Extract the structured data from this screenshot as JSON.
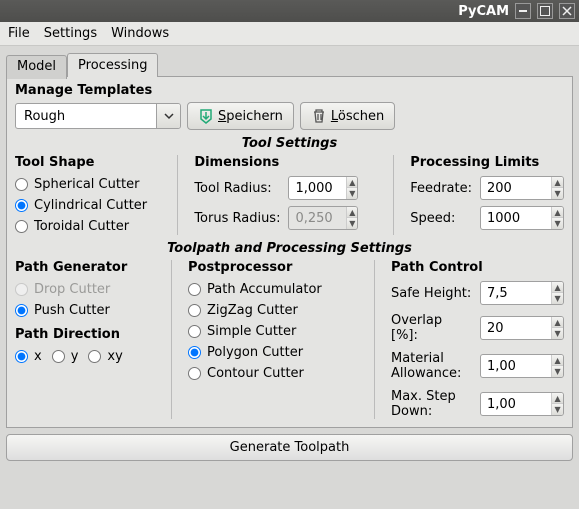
{
  "window": {
    "title": "PyCAM"
  },
  "menu": {
    "file": "File",
    "settings": "Settings",
    "windows": "Windows"
  },
  "tabs": {
    "model": "Model",
    "processing": "Processing"
  },
  "templates": {
    "heading": "Manage Templates",
    "value": "Rough",
    "save": "Speichern",
    "delete": "Löschen"
  },
  "tool_settings": {
    "title": "Tool Settings",
    "shape": {
      "heading": "Tool Shape",
      "spherical": "Spherical Cutter",
      "cylindrical": "Cylindrical Cutter",
      "toroidal": "Toroidal Cutter"
    },
    "dimensions": {
      "heading": "Dimensions",
      "tool_radius_label": "Tool Radius:",
      "tool_radius_value": "1,000",
      "torus_radius_label": "Torus Radius:",
      "torus_radius_value": "0,250"
    },
    "limits": {
      "heading": "Processing Limits",
      "feedrate_label": "Feedrate:",
      "feedrate_value": "200",
      "speed_label": "Speed:",
      "speed_value": "1000"
    }
  },
  "toolpath": {
    "title": "Toolpath and Processing Settings",
    "generator": {
      "heading": "Path Generator",
      "drop": "Drop Cutter",
      "push": "Push Cutter"
    },
    "direction": {
      "heading": "Path Direction",
      "x": "x",
      "y": "y",
      "xy": "xy"
    },
    "postprocessor": {
      "heading": "Postprocessor",
      "accumulator": "Path Accumulator",
      "zigzag": "ZigZag Cutter",
      "simple": "Simple Cutter",
      "polygon": "Polygon Cutter",
      "contour": "Contour Cutter"
    },
    "control": {
      "heading": "Path Control",
      "safe_height_label": "Safe Height:",
      "safe_height_value": "7,5",
      "overlap_label": "Overlap [%]:",
      "overlap_value": "20",
      "allowance_label": "Material Allowance:",
      "allowance_value": "1,00",
      "step_down_label": "Max. Step Down:",
      "step_down_value": "1,00"
    }
  },
  "generate": "Generate Toolpath"
}
